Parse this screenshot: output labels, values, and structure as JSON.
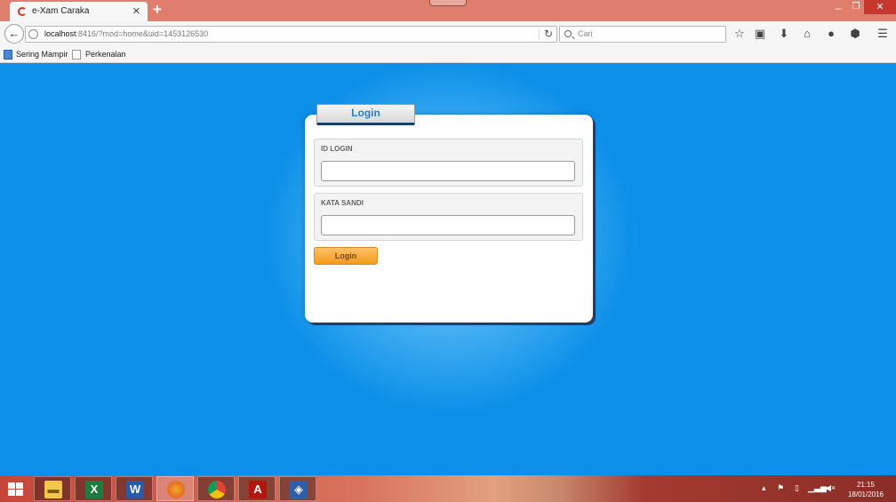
{
  "browser": {
    "tab_title": "e-Xam Caraka",
    "url_host": "localhost",
    "url_rest": ":8416/?mod=home&uid=1453126530",
    "search_placeholder": "Cari",
    "icons": [
      "tab-favicon",
      "close-icon",
      "new-tab-icon",
      "back-arrow-icon",
      "globe-icon",
      "reload-icon",
      "search-icon",
      "star-icon",
      "clipboard-icon",
      "download-icon",
      "home-icon",
      "chat-icon",
      "addon-icon",
      "menu-icon"
    ]
  },
  "bookmarks": [
    {
      "label": "Sering Mampir"
    },
    {
      "label": "Perkenalan"
    }
  ],
  "login": {
    "tab_label": "Login",
    "id_label": "ID LOGIN",
    "id_value": "",
    "password_label": "KATA SANDI",
    "password_value": "",
    "submit_label": "Login"
  },
  "taskbar": {
    "apps": [
      "file-explorer",
      "excel",
      "word",
      "firefox",
      "chrome",
      "acrobat",
      "virtualbox"
    ],
    "active_app": "firefox",
    "time": "21:15",
    "date": "18/01/2016"
  },
  "colors": {
    "page_background": "#0b8fe8",
    "title_bar": "#e07d6c",
    "login_button": "#f39a1a",
    "login_tab_text": "#2a7fcb"
  }
}
